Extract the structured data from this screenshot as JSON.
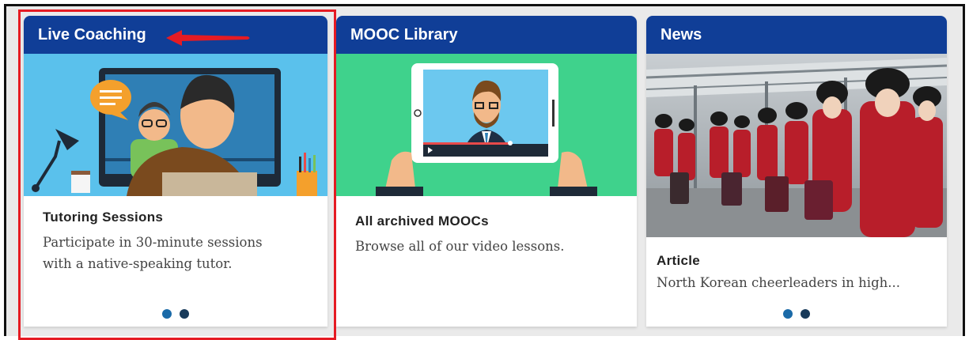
{
  "cards": [
    {
      "header": "Live Coaching",
      "title": "Tutoring Sessions",
      "description_line1": "Participate in 30-minute sessions",
      "description_line2": "with a native-speaking tutor."
    },
    {
      "header": "MOOC Library",
      "title": "All archived MOOCs",
      "description_line1": "Browse all of our video lessons."
    },
    {
      "header": "News",
      "title": "Article",
      "description_line1": "North Korean cheerleaders in high..."
    }
  ],
  "carousel": {
    "total_dots": 2,
    "active_index": 0
  },
  "colors": {
    "header_bg": "#103e97",
    "highlight": "#e51b23",
    "live_art_bg": "#5ac1ec",
    "mooc_art_bg": "#3fd28c",
    "dot_active": "#1a6aa8",
    "dot_inactive": "#183a5a"
  },
  "icons": {
    "annotation": "red-arrow-icon",
    "live_illustration": "tutor-video-call-illustration",
    "mooc_illustration": "tablet-video-player-illustration",
    "news_photo": "cheerleaders-photo"
  }
}
